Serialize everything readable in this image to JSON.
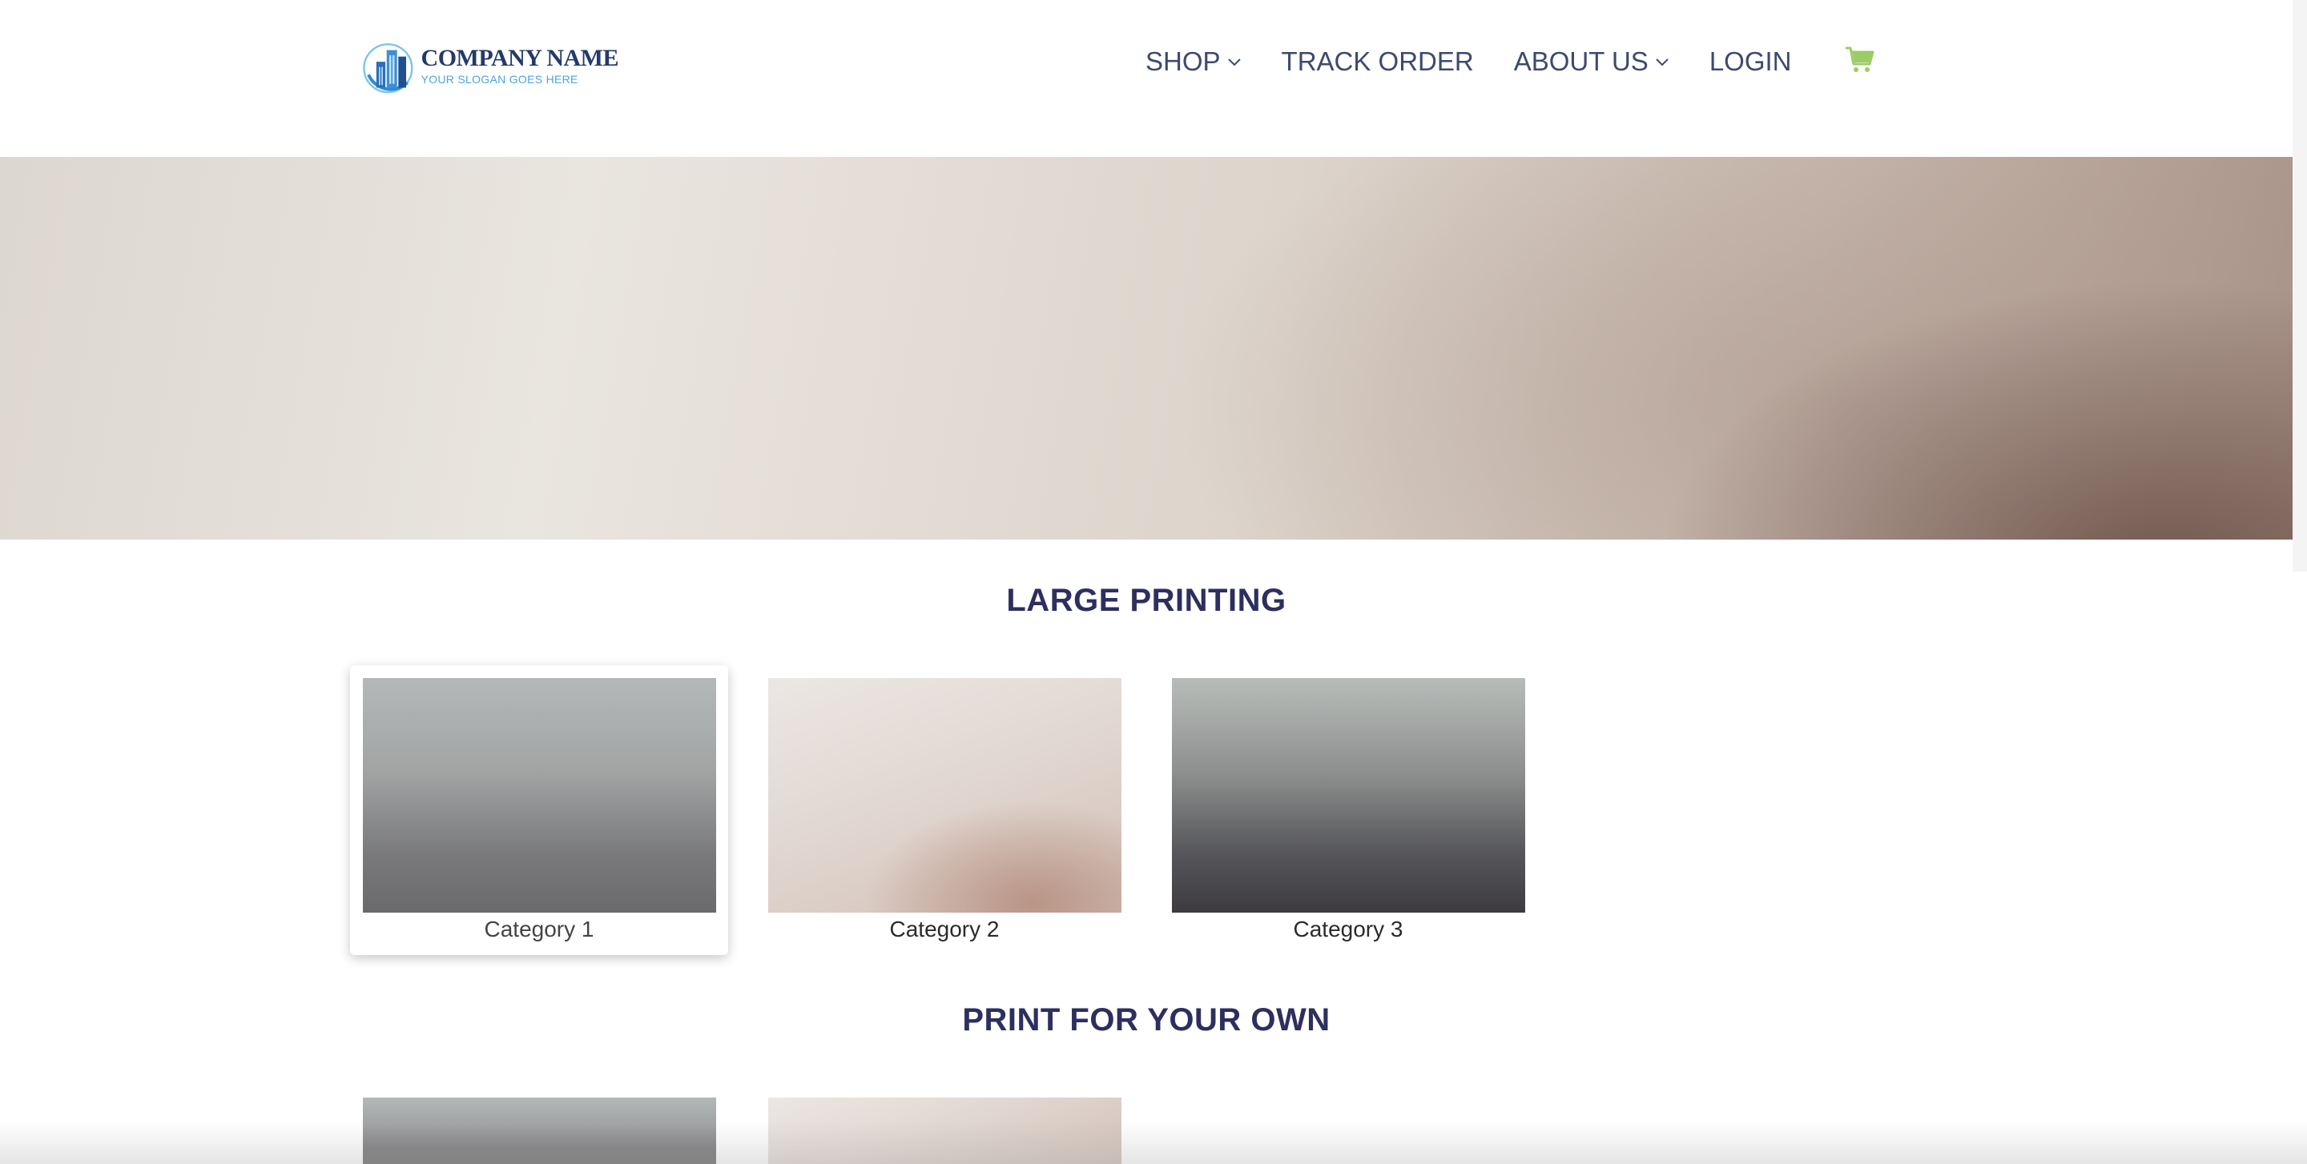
{
  "brand": {
    "name": "COMPANY NAME",
    "slogan": "YOUR SLOGAN GOES HERE"
  },
  "nav": {
    "shop": "SHOP",
    "track_order": "TRACK ORDER",
    "about_us": "ABOUT US",
    "login": "LOGIN"
  },
  "colors": {
    "nav_text": "#3d4a6b",
    "heading": "#2d2f5e",
    "cart": "#9ccc65",
    "logo_blue": "#4aa6e0"
  },
  "sections": [
    {
      "title": "LARGE PRINTING",
      "categories": [
        {
          "label": "Category 1"
        },
        {
          "label": "Category 2"
        },
        {
          "label": "Category 3"
        }
      ]
    },
    {
      "title": "PRINT FOR YOUR OWN"
    }
  ]
}
